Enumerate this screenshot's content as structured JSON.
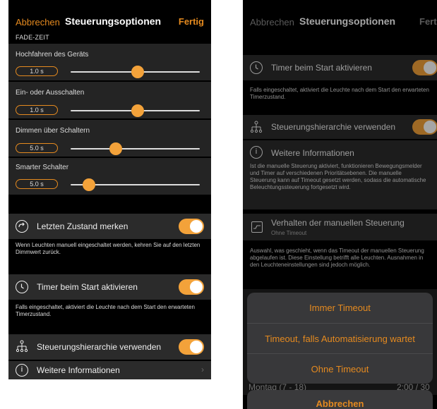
{
  "left": {
    "nav": {
      "cancel": "Abbrechen",
      "title": "Steuerungsoptionen",
      "done": "Fertig"
    },
    "section_fade": "FADE-ZEIT",
    "fades": [
      {
        "label": "Hochfahren des Geräts",
        "value": "1.0 s",
        "slider": 0.52
      },
      {
        "label": "Ein- oder Ausschalten",
        "value": "1.0 s",
        "slider": 0.52
      },
      {
        "label": "Dimmen über Schaltern",
        "value": "5.0 s",
        "slider": 0.35
      },
      {
        "label": "Smarter Schalter",
        "value": "5.0 s",
        "slider": 0.14
      }
    ],
    "remember": {
      "label": "Letzten Zustand merken",
      "note": "Wenn Leuchten manuell  eingeschaltet werden, kehren Sie auf den letzten Dimmwert zurück."
    },
    "timer": {
      "label": "Timer beim Start aktivieren",
      "note": "Falls eingeschaltet, aktiviert die Leuchte nach dem Start den erwarteten Timerzustand."
    },
    "hierarchy": {
      "label": "Steuerungshierarchie verwenden"
    },
    "more_info": {
      "label": "Weitere Informationen",
      "chevron": "›"
    }
  },
  "right": {
    "nav": {
      "cancel": "Abbrechen",
      "title": "Steuerungsoptionen",
      "done": "Fertig"
    },
    "timer": {
      "label": "Timer beim Start aktivieren",
      "note": "Falls eingeschaltet, aktiviert die Leuchte nach dem Start den erwarteten Timerzustand."
    },
    "hierarchy": {
      "label": "Steuerungshierarchie verwenden"
    },
    "more_info": {
      "label": "Weitere Informationen",
      "text": "Ist die manuelle Steuerung aktiviert, funktionieren Bewegungsmelder und Timer auf verschiedenen Prioritätsebenen. Die manuelle Steuerung kann auf Timeout gesetzt werden, sodass die automatische Beleuchtungssteuerung fortgesetzt wird."
    },
    "manual": {
      "label": "Verhalten der manuellen Steuerung",
      "sub": "Ohne Timeout",
      "note": "Auswahl, was geschieht, wenn das Timeout der manuellen Steuerung abgelaufen ist. Diese Einstellung betrifft alle Leuchten. Ausnahmen in den Leuchteneinstellungen sind jedoch möglich."
    },
    "sheet": {
      "options": [
        "Immer Timeout",
        "Timeout, falls Automatisierung wartet",
        "Ohne Timeout"
      ],
      "cancel": "Abbrechen"
    },
    "behind": {
      "left": "Montag (7 - 18)",
      "right": "2:00 / 30"
    }
  },
  "colors": {
    "accent": "#e58a1f",
    "background": "#000000",
    "row": "#2b2b2b"
  }
}
